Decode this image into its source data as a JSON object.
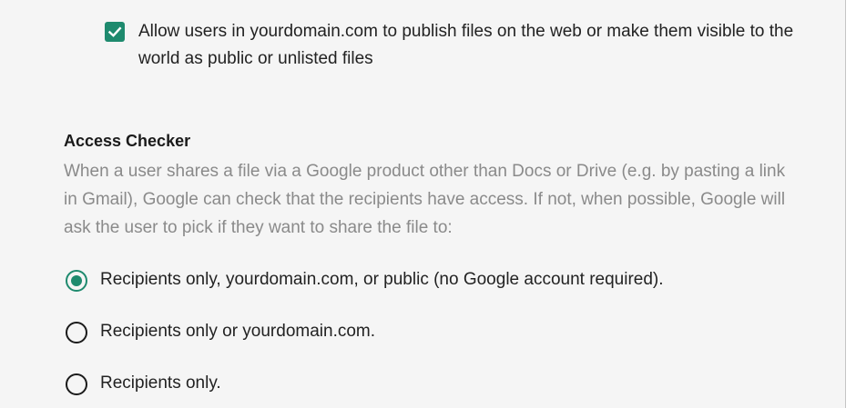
{
  "publish_setting": {
    "checked": true,
    "label": "Allow users in yourdomain.com to publish files on the web or make them visible to the world as public or unlisted files"
  },
  "access_checker": {
    "title": "Access Checker",
    "description": "When a user shares a file via a Google product other than Docs or Drive (e.g. by pasting a link in Gmail), Google can check that the recipients have access. If not, when possible, Google will ask the user to pick if they want to share the file to:",
    "options": [
      {
        "label": "Recipients only, yourdomain.com, or public (no Google account required).",
        "selected": true
      },
      {
        "label": "Recipients only or yourdomain.com.",
        "selected": false
      },
      {
        "label": "Recipients only.",
        "selected": false
      }
    ]
  },
  "colors": {
    "accent": "#1e8a6e",
    "panel_bg": "#f5f5f5",
    "muted_text": "#8a8a8a"
  }
}
